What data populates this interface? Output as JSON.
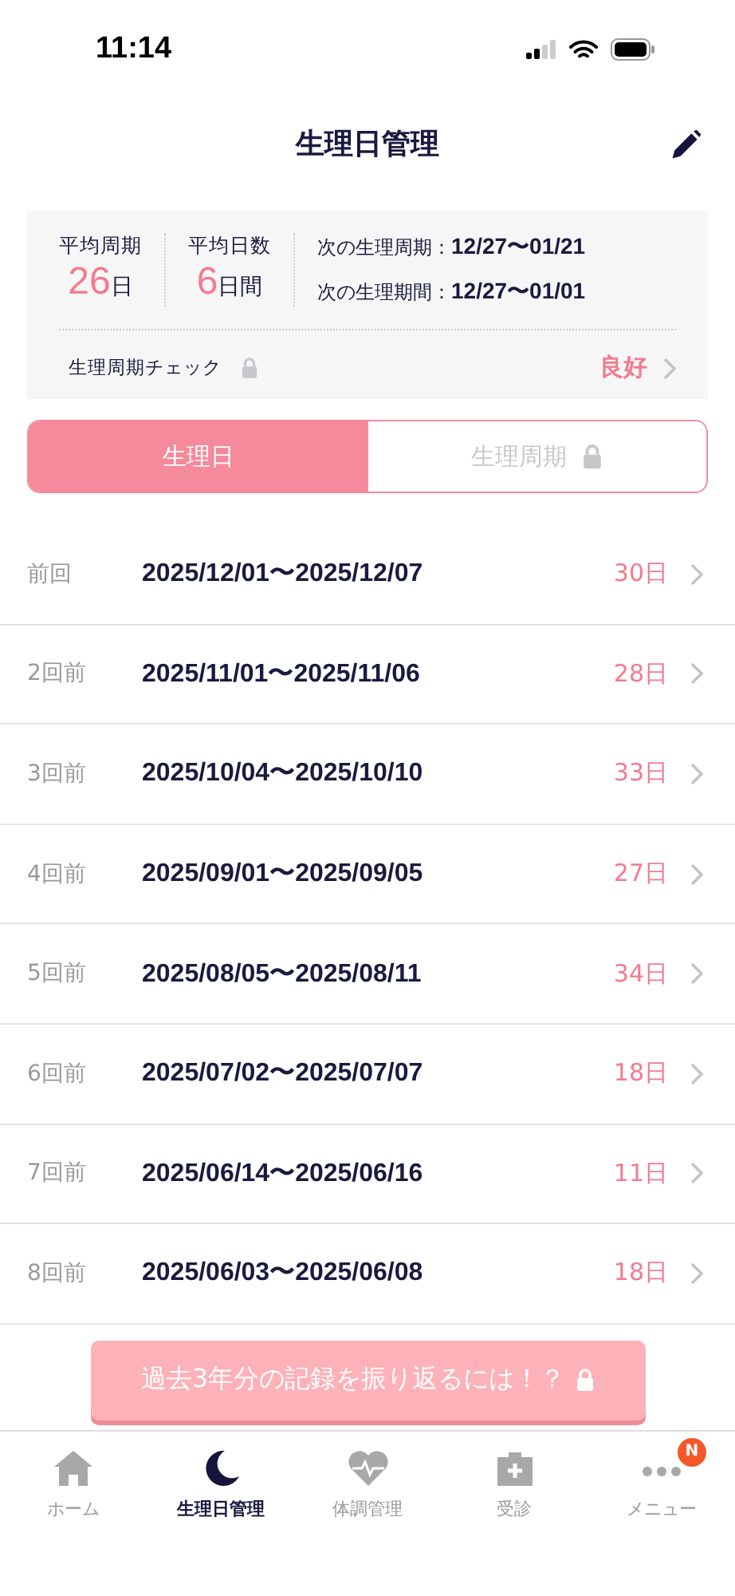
{
  "status_bar": {
    "time": "11:14"
  },
  "header": {
    "title": "生理日管理"
  },
  "summary": {
    "avg_cycle": {
      "label": "平均周期",
      "value": "26",
      "unit": "日"
    },
    "avg_days": {
      "label": "平均日数",
      "value": "6",
      "unit": "日間"
    },
    "next": [
      {
        "label": "次の生理周期：",
        "value": "12/27〜01/21"
      },
      {
        "label": "次の生理期間：",
        "value": "12/27〜01/01"
      }
    ],
    "check": {
      "label": "生理周期チェック",
      "result": "良好"
    }
  },
  "segments": [
    {
      "label": "生理日",
      "selected": true,
      "locked": false
    },
    {
      "label": "生理周期",
      "selected": false,
      "locked": true
    }
  ],
  "records": [
    {
      "label": "前回",
      "dates": "2025/12/01〜2025/12/07",
      "days": "30日"
    },
    {
      "label": "2回前",
      "dates": "2025/11/01〜2025/11/06",
      "days": "28日"
    },
    {
      "label": "3回前",
      "dates": "2025/10/04〜2025/10/10",
      "days": "33日"
    },
    {
      "label": "4回前",
      "dates": "2025/09/01〜2025/09/05",
      "days": "27日"
    },
    {
      "label": "5回前",
      "dates": "2025/08/05〜2025/08/11",
      "days": "34日"
    },
    {
      "label": "6回前",
      "dates": "2025/07/02〜2025/07/07",
      "days": "18日"
    },
    {
      "label": "7回前",
      "dates": "2025/06/14〜2025/06/16",
      "days": "11日"
    },
    {
      "label": "8回前",
      "dates": "2025/06/03〜2025/06/08",
      "days": "18日"
    }
  ],
  "promo_button": {
    "label": "過去3年分の記録を振り返るには！？"
  },
  "tab_bar": [
    {
      "kind": "home",
      "label": "ホーム",
      "selected": false
    },
    {
      "kind": "moon",
      "label": "生理日管理",
      "selected": true
    },
    {
      "kind": "heart",
      "label": "体調管理",
      "selected": false
    },
    {
      "kind": "clinic",
      "label": "受診",
      "selected": false
    },
    {
      "kind": "menu",
      "label": "メニュー",
      "selected": false,
      "badge": "N"
    }
  ]
}
